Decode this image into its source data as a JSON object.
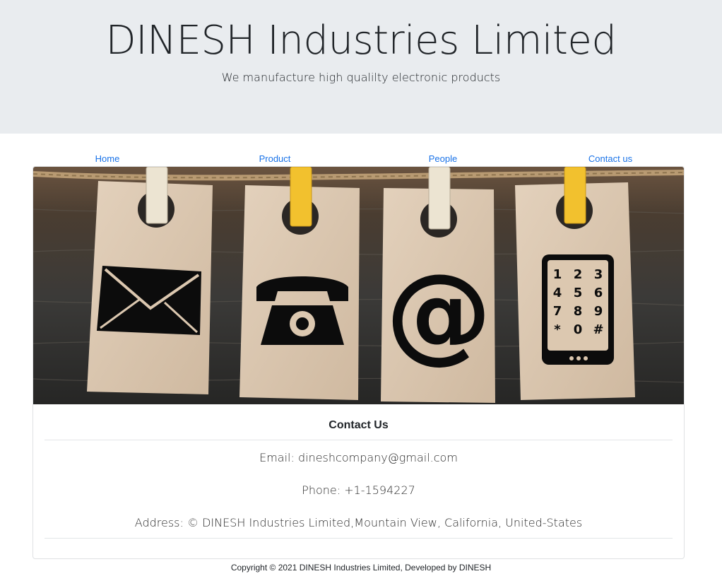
{
  "header": {
    "title": "DINESH Industries Limited",
    "tagline": "We manufacture high qualilty electronic products"
  },
  "nav": {
    "items": [
      {
        "label": "Home"
      },
      {
        "label": "Product"
      },
      {
        "label": "People"
      },
      {
        "label": "Contact us"
      }
    ]
  },
  "hero": {
    "image_description_icons": [
      "envelope-icon",
      "telephone-icon",
      "at-sign-icon",
      "keypad-phone-icon"
    ],
    "keypad": {
      "keys": [
        "1",
        "2",
        "3",
        "4",
        "5",
        "6",
        "7",
        "8",
        "9",
        "*",
        "0",
        "#"
      ]
    },
    "at_symbol": "@"
  },
  "contact": {
    "title": "Contact Us",
    "email": "Email: dineshcompany@gmail.com",
    "phone": "Phone: +1-1594227",
    "address": "Address: © DINESH Industries Limited,Mountain View, California, United-States"
  },
  "footer": {
    "copyright": "Copyright © 2021 DINESH Industries Limited, Developed by DINESH"
  },
  "colors": {
    "jumbotron_bg": "#e9ecef",
    "link": "#1a73e8",
    "tag_paper": "#dcc8b0",
    "clothespin_yellow": "#f2c12e",
    "clothespin_white": "#ece4d2",
    "wood_dark": "#2e2b27"
  }
}
